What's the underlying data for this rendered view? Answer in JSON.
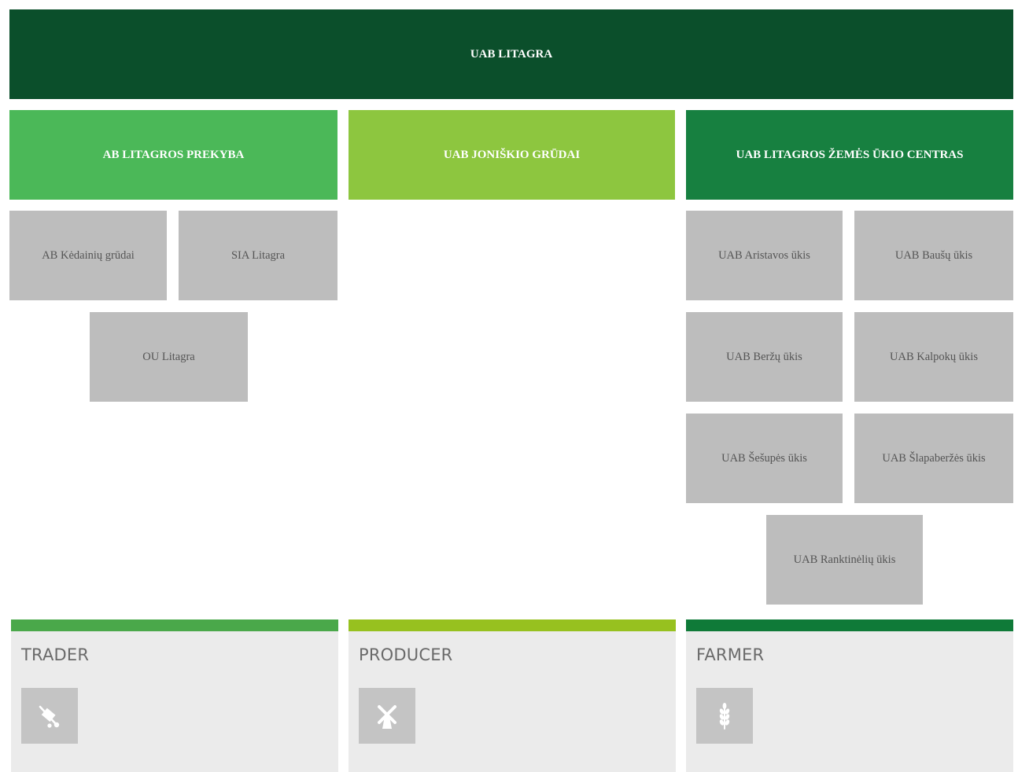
{
  "root": {
    "label": "UAB LITAGRA"
  },
  "divisions": [
    {
      "label": "AB LITAGROS PREKYBA",
      "color": "#4bb858"
    },
    {
      "label": "UAB JONIŠKIO GRŪDAI",
      "color": "#8dc63f"
    },
    {
      "label": "UAB LITAGROS ŽEMĖS ŪKIO CENTRAS",
      "color": "#178040"
    }
  ],
  "subsidiaries": {
    "prekyba": [
      "AB Kėdainių grūdai",
      "SIA Litagra",
      "OU Litagra"
    ],
    "centras": [
      "UAB Aristavos ūkis",
      "UAB Baušų ūkis",
      "UAB Beržų ūkis",
      "UAB Kalpokų ūkis",
      "UAB Šešupės ūkis",
      "UAB Šlapaberžės ūkis",
      "UAB Ranktinėlių ūkis"
    ]
  },
  "categories": [
    {
      "label": "TRADER",
      "icon": "hand-truck-icon",
      "color": "#4aa84a"
    },
    {
      "label": "PRODUCER",
      "icon": "windmill-icon",
      "color": "#97c11f"
    },
    {
      "label": "FARMER",
      "icon": "wheat-icon",
      "color": "#0f7a38"
    }
  ]
}
